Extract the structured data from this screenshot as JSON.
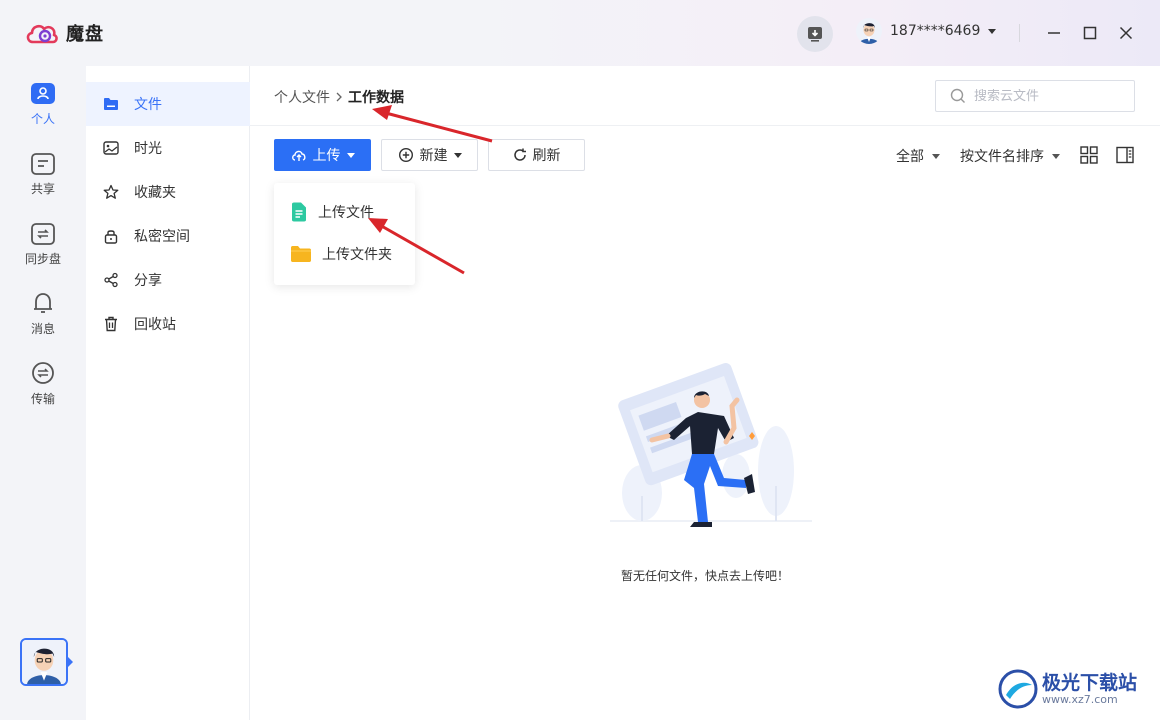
{
  "app": {
    "name": "魔盘"
  },
  "titlebar": {
    "phone": "187****6469"
  },
  "rail": {
    "items": [
      {
        "label": "个人",
        "icon": "person-icon"
      },
      {
        "label": "共享",
        "icon": "share-folder-icon"
      },
      {
        "label": "同步盘",
        "icon": "sync-icon"
      },
      {
        "label": "消息",
        "icon": "bell-icon"
      },
      {
        "label": "传输",
        "icon": "transfer-icon"
      }
    ]
  },
  "sidebar": {
    "items": [
      {
        "label": "文件",
        "icon": "folder-icon"
      },
      {
        "label": "时光",
        "icon": "photo-icon"
      },
      {
        "label": "收藏夹",
        "icon": "star-icon"
      },
      {
        "label": "私密空间",
        "icon": "lock-icon"
      },
      {
        "label": "分享",
        "icon": "share-icon"
      },
      {
        "label": "回收站",
        "icon": "trash-icon"
      }
    ]
  },
  "main": {
    "breadcrumb": {
      "root": "个人文件",
      "current": "工作数据"
    },
    "search": {
      "placeholder": "搜索云文件"
    },
    "toolbar": {
      "upload": "上传",
      "new": "新建",
      "refresh": "刷新"
    },
    "filters": {
      "scope": "全部",
      "sort": "按文件名排序"
    },
    "upload_menu": [
      {
        "label": "上传文件",
        "icon": "file-icon"
      },
      {
        "label": "上传文件夹",
        "icon": "folder-icon"
      }
    ],
    "empty_text": "暂无任何文件，快点去上传吧！"
  },
  "watermark": {
    "name": "极光下载站",
    "url": "www.xz7.com"
  },
  "colors": {
    "accent": "#2b6ff5",
    "annotation": "#d9262b"
  }
}
